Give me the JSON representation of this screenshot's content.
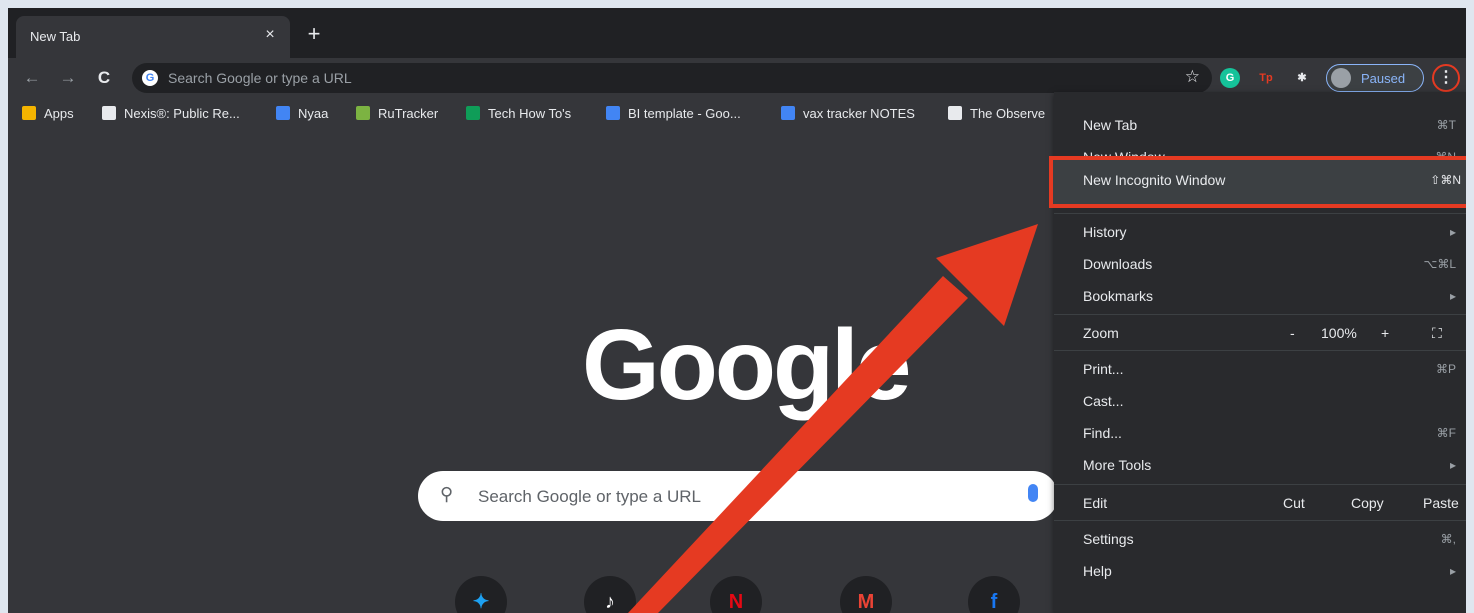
{
  "tab": {
    "title": "New Tab",
    "close": "×"
  },
  "new_tab_button": "+",
  "nav": {
    "back": "←",
    "forward": "→",
    "reload": "C"
  },
  "omnibox": {
    "placeholder": "Search Google or type a URL",
    "g_icon": "G"
  },
  "star": "☆",
  "extensions": [
    {
      "name": "grammarly-icon",
      "label": "G",
      "bg": "#15c39a",
      "fg": "#ffffff"
    },
    {
      "name": "tp-extension-icon",
      "label": "Tp",
      "bg": "transparent",
      "fg": "#e53a22"
    },
    {
      "name": "puzzle-icon",
      "label": "✱",
      "bg": "transparent",
      "fg": "#e8eaed"
    }
  ],
  "profile": {
    "label": "Paused"
  },
  "menu_button": "⋮",
  "bookmarks": [
    {
      "name": "bookmark-apps",
      "label": "Apps",
      "color": "#f4b400"
    },
    {
      "name": "bookmark-nexis",
      "label": "Nexis®: Public Re...",
      "color": "#e8eaed"
    },
    {
      "name": "bookmark-nyaa",
      "label": "Nyaa",
      "color": "#4285f4"
    },
    {
      "name": "bookmark-rutracker",
      "label": "RuTracker",
      "color": "#7cb342"
    },
    {
      "name": "bookmark-tech-how-tos",
      "label": "Tech How To's",
      "color": "#0f9d58"
    },
    {
      "name": "bookmark-bi-template",
      "label": "BI template - Goo...",
      "color": "#4285f4"
    },
    {
      "name": "bookmark-vax-tracker",
      "label": "vax tracker NOTES",
      "color": "#4285f4"
    },
    {
      "name": "bookmark-the-observer",
      "label": "The Observe",
      "color": "#e8eaed"
    }
  ],
  "logo": "Google",
  "search": {
    "placeholder": "Search Google or type a URL"
  },
  "shortcuts": [
    {
      "name": "twitter-shortcut",
      "icon": "✦",
      "color": "#1da1f2"
    },
    {
      "name": "tiktok-shortcut",
      "icon": "♪",
      "color": "#ffffff"
    },
    {
      "name": "netflix-shortcut",
      "icon": "N",
      "color": "#e50914"
    },
    {
      "name": "gmail-shortcut",
      "icon": "M",
      "color": "#ea4335"
    },
    {
      "name": "facebook-shortcut",
      "icon": "f",
      "color": "#1877f2"
    }
  ],
  "menu": {
    "new_tab": {
      "label": "New Tab",
      "shortcut": "⌘T"
    },
    "new_window": {
      "label": "New Window",
      "shortcut": "⌘N"
    },
    "new_incognito": {
      "label": "New Incognito Window",
      "shortcut": "⇧⌘N"
    },
    "history": {
      "label": "History",
      "arrow": "▸"
    },
    "downloads": {
      "label": "Downloads",
      "shortcut": "⌥⌘L"
    },
    "bookmarks": {
      "label": "Bookmarks",
      "arrow": "▸"
    },
    "zoom": {
      "label": "Zoom",
      "minus": "-",
      "value": "100%",
      "plus": "+",
      "fullscreen": "⛶"
    },
    "print": {
      "label": "Print...",
      "shortcut": "⌘P"
    },
    "cast": {
      "label": "Cast..."
    },
    "find": {
      "label": "Find...",
      "shortcut": "⌘F"
    },
    "more_tools": {
      "label": "More Tools",
      "arrow": "▸"
    },
    "edit": {
      "label": "Edit",
      "cut": "Cut",
      "copy": "Copy",
      "paste": "Paste"
    },
    "settings": {
      "label": "Settings",
      "shortcut": "⌘,"
    },
    "help": {
      "label": "Help",
      "arrow": "▸"
    }
  },
  "annotation_color": "#e53a22"
}
